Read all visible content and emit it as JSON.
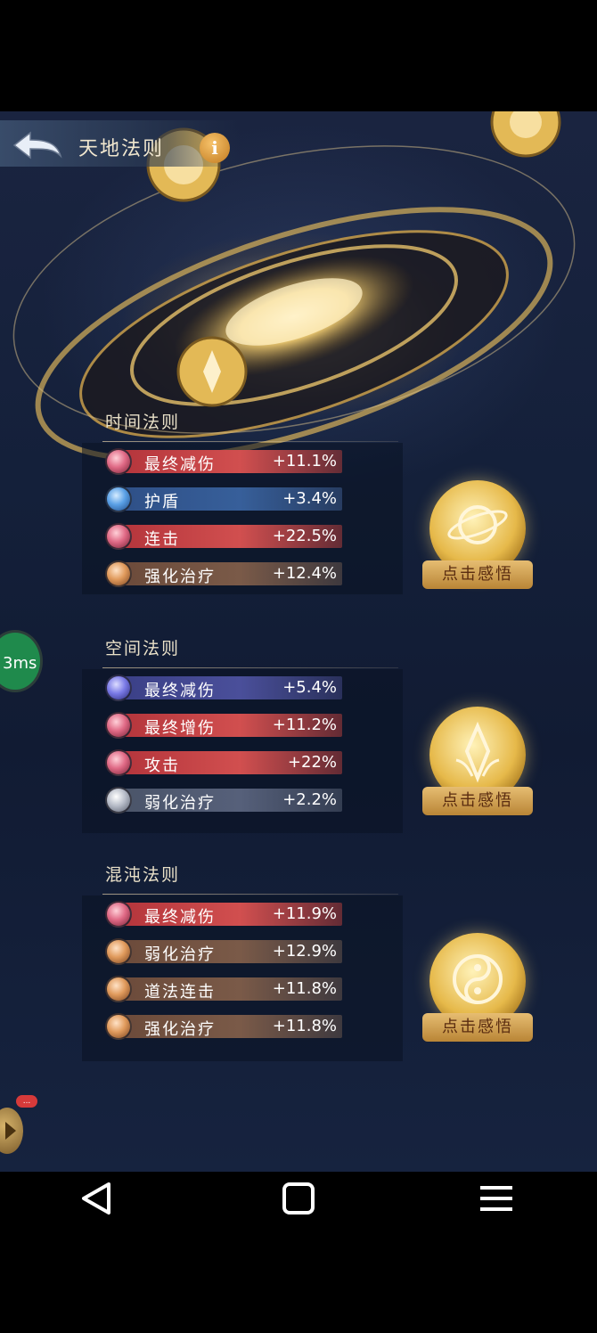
{
  "header": {
    "title": "天地法则",
    "info_icon": "i"
  },
  "ping": {
    "label": "3ms"
  },
  "side_badge": {
    "label": "..."
  },
  "sections": [
    {
      "title": "时间法则",
      "stats": [
        {
          "name": "最终减伤",
          "value": "+11.1%",
          "color": "red"
        },
        {
          "name": "护盾",
          "value": "+3.4%",
          "color": "blue"
        },
        {
          "name": "连击",
          "value": "+22.5%",
          "color": "red"
        },
        {
          "name": "强化治疗",
          "value": "+12.4%",
          "color": "orange"
        }
      ],
      "button": "点击感悟",
      "medal_icon": "planet-icon"
    },
    {
      "title": "空间法则",
      "stats": [
        {
          "name": "最终减伤",
          "value": "+5.4%",
          "color": "indigo"
        },
        {
          "name": "最终增伤",
          "value": "+11.2%",
          "color": "red"
        },
        {
          "name": "攻击",
          "value": "+22%",
          "color": "red"
        },
        {
          "name": "弱化治疗",
          "value": "+2.2%",
          "color": "grey"
        }
      ],
      "button": "点击感悟",
      "medal_icon": "crystal-icon"
    },
    {
      "title": "混沌法则",
      "stats": [
        {
          "name": "最终减伤",
          "value": "+11.9%",
          "color": "red"
        },
        {
          "name": "弱化治疗",
          "value": "+12.9%",
          "color": "orange"
        },
        {
          "name": "道法连击",
          "value": "+11.8%",
          "color": "orange"
        },
        {
          "name": "强化治疗",
          "value": "+11.8%",
          "color": "orange"
        }
      ],
      "button": "点击感悟",
      "medal_icon": "yin-yang-icon"
    }
  ]
}
